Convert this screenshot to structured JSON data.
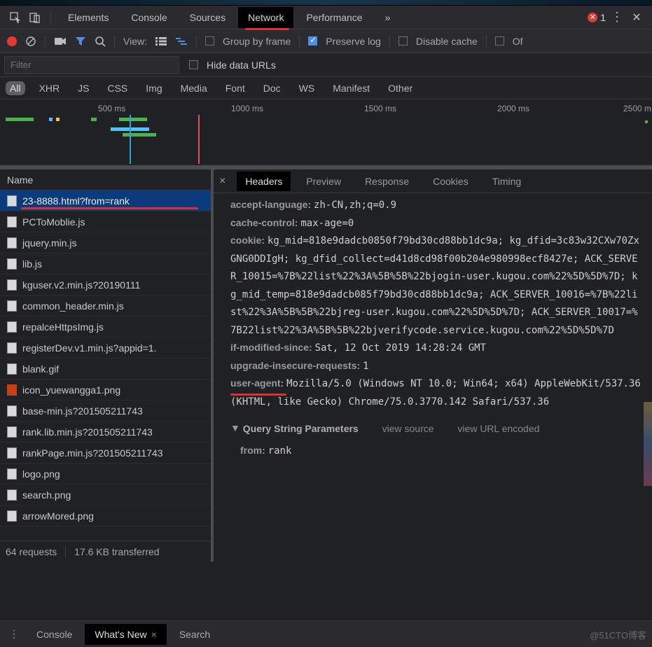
{
  "tabs": {
    "items": [
      "Elements",
      "Console",
      "Sources",
      "Network",
      "Performance"
    ],
    "active": "Network",
    "overflow_glyph": "»",
    "error_count": "1"
  },
  "toolbar": {
    "view_label": "View:",
    "group_by_frame": "Group by frame",
    "preserve_log": "Preserve log",
    "disable_cache": "Disable cache",
    "offline": "Of"
  },
  "filter": {
    "placeholder": "Filter",
    "hide_data_urls": "Hide data URLs"
  },
  "type_filters": [
    "All",
    "XHR",
    "JS",
    "CSS",
    "Img",
    "Media",
    "Font",
    "Doc",
    "WS",
    "Manifest",
    "Other"
  ],
  "type_filters_active": "All",
  "timeline": {
    "ticks": [
      "500 ms",
      "1000 ms",
      "1500 ms",
      "2000 ms",
      "2500 m"
    ]
  },
  "files_header": "Name",
  "files": [
    {
      "name": "23-8888.html?from=rank",
      "selected": true,
      "ink": true,
      "icon": "doc"
    },
    {
      "name": "PCToMoblie.js",
      "icon": "doc"
    },
    {
      "name": "jquery.min.js",
      "icon": "doc"
    },
    {
      "name": "lib.js",
      "icon": "doc"
    },
    {
      "name": "kguser.v2.min.js?20190111",
      "icon": "doc"
    },
    {
      "name": "common_header.min.js",
      "icon": "doc"
    },
    {
      "name": "repalceHttpsImg.js",
      "icon": "doc"
    },
    {
      "name": "registerDev.v1.min.js?appid=1.",
      "icon": "doc"
    },
    {
      "name": "blank.gif",
      "icon": "doc"
    },
    {
      "name": "icon_yuewangga1.png",
      "icon": "img"
    },
    {
      "name": "base-min.js?201505211743",
      "icon": "doc"
    },
    {
      "name": "rank.lib.min.js?201505211743",
      "icon": "doc"
    },
    {
      "name": "rankPage.min.js?201505211743",
      "icon": "doc"
    },
    {
      "name": "logo.png",
      "icon": "doc"
    },
    {
      "name": "search.png",
      "icon": "doc"
    },
    {
      "name": "arrowMored.png",
      "icon": "doc"
    }
  ],
  "footer": {
    "requests": "64 requests",
    "transferred": "17.6 KB transferred"
  },
  "detail_tabs": [
    "Headers",
    "Preview",
    "Response",
    "Cookies",
    "Timing"
  ],
  "detail_tabs_active": "Headers",
  "headers": {
    "accept_language_k": "accept-language:",
    "accept_language_v": "zh-CN,zh;q=0.9",
    "cache_control_k": "cache-control:",
    "cache_control_v": "max-age=0",
    "cookie_k": "cookie:",
    "cookie_v": "kg_mid=818e9dadcb0850f79bd30cd88bb1dc9a; kg_dfid=3c83w32CXw70ZxGNG0DDIgH; kg_dfid_collect=d41d8cd98f00b204e980998ecf8427e; ACK_SERVER_10015=%7B%22list%22%3A%5B%5B%22bjogin-user.kugou.com%22%5D%5D%7D; kg_mid_temp=818e9dadcb085f79bd30cd88bb1dc9a; ACK_SERVER_10016=%7B%22list%22%3A%5B%5B%22bjreg-user.kugou.com%22%5D%5D%7D; ACK_SERVER_10017=%7B22list%22%3A%5B%5B%22bjverifycode.service.kugou.com%22%5D%5D%7D",
    "if_modified_k": "if-modified-since:",
    "if_modified_v": "Sat, 12 Oct 2019 14:28:24 GMT",
    "upgrade_k": "upgrade-insecure-requests:",
    "upgrade_v": "1",
    "ua_k": "user-agent:",
    "ua_v": "Mozilla/5.0 (Windows NT 10.0; Win64; x64) AppleWebKit/537.36 (KHTML, like Gecko) Chrome/75.0.3770.142 Safari/537.36"
  },
  "qsp": {
    "title": "Query String Parameters",
    "view_source": "view source",
    "view_encoded": "view URL encoded",
    "from_k": "from:",
    "from_v": "rank"
  },
  "drawer": {
    "console": "Console",
    "whatsnew": "What's New",
    "search": "Search"
  },
  "watermark": "@51CTO博客"
}
